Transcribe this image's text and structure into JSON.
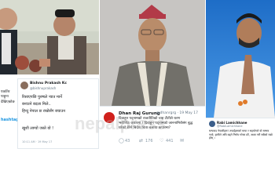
{
  "left_tweet": {
    "name": "Bishnu Prakash Kc",
    "handle": "@bishnuprakash",
    "line1": "रिसाएपछि पुरुषले र्‍यात मार्ने",
    "line2": "बनाउने बदला मिले..",
    "line3": "हिन्दु नेपाल  छ राम्रोसँग बचाउन",
    "footer": "खुशी लाग्यो जस्ते यो !",
    "link": "#hashtag",
    "meta": "10:11 AM · 19 May 17",
    "partial_text": "एकतिर\nपाहुना\nदेखिएकोछ",
    "partial_link": "hashtagk/"
  },
  "mid_tweet": {
    "name": "Dhan Raj Gurung",
    "handle": "@dhanrgrg · 19 May 17",
    "line1": "दिवाहुन पद्नामको राजतीतिको चाह टीतीले धरण",
    "line2": "भरतिपेठ कपारमा / दिवाहुन पद्नामको जाननामिरोसंग बुद्ध",
    "line3": "घरेको डेरेने बिदेश चिता चलाया कपारमा?",
    "stat_reply": "43",
    "stat_retweet": "176",
    "stat_like": "441"
  },
  "right_tweet": {
    "name": "Rabi Lamichhane",
    "handle": "@RabiLamichhane",
    "text": "धन्यवाद नेपालीहरू! तपाईंहरूको माया र सहयोगले यो सम्भव भयो, हामीले अघि बढ्ने निर्णय गरेका छौं, आशा गरौं सबैको राम्रो होस् ।"
  },
  "watermark": "nepalpress",
  "colors": {
    "twitter_blue": "#1b95e0",
    "sky_blue": "#2b7fd7",
    "gray_bg": "#c7c5c2"
  },
  "icons": [
    "reply-icon",
    "retweet-icon",
    "like-icon",
    "mail-icon"
  ]
}
